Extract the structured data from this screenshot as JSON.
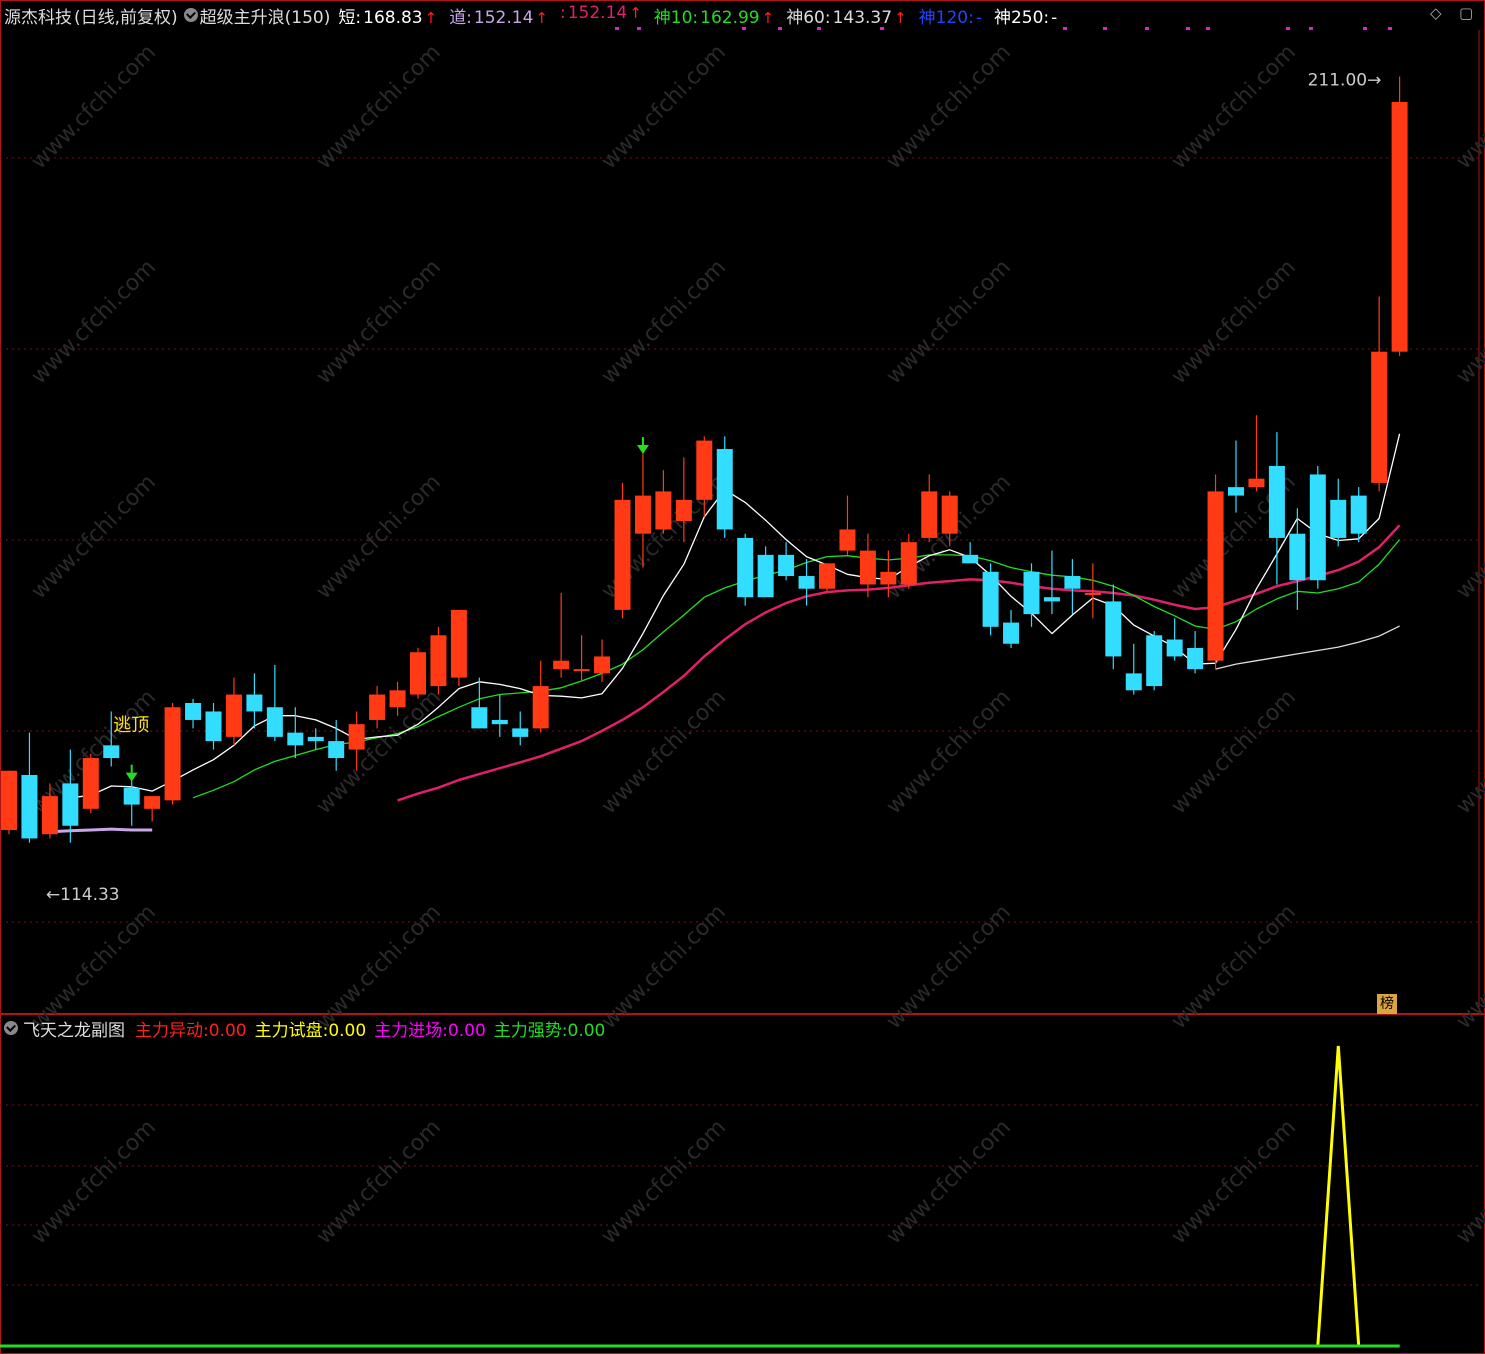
{
  "header": {
    "stock_name": "源杰科技",
    "period": "(日线,前复权)",
    "indicator_name": "超级主升浪(150)",
    "items": [
      {
        "label": "短:",
        "value": "168.83",
        "arrow": "↑",
        "label_color": "#ffffff",
        "value_color": "#ffffff"
      },
      {
        "label": "道:",
        "value": "152.14",
        "arrow": "↑",
        "label_color": "#c8a6e8",
        "value_color": "#c8a6e8"
      },
      {
        "label": ":",
        "value": "152.14",
        "arrow": "↑",
        "label_color": "#e0206a",
        "value_color": "#e0206a"
      },
      {
        "label": "神10:",
        "value": "162.99",
        "arrow": "↑",
        "label_color": "#22dd22",
        "value_color": "#22dd22"
      },
      {
        "label": "神60:",
        "value": "143.37",
        "arrow": "↑",
        "label_color": "#dddddd",
        "value_color": "#dddddd"
      },
      {
        "label": "神120:",
        "value": "-",
        "arrow": "",
        "label_color": "#2244ff",
        "value_color": "#2244ff"
      },
      {
        "label": "神250:",
        "value": "-",
        "arrow": "",
        "label_color": "#ffffff",
        "value_color": "#ffffff"
      }
    ]
  },
  "sub_header": {
    "title": "飞天之龙副图",
    "items": [
      {
        "label": "主力异动:",
        "value": "0.00",
        "color": "#ff2020"
      },
      {
        "label": "主力试盘:",
        "value": "0.00",
        "color": "#ffff00"
      },
      {
        "label": "主力进场:",
        "value": "0.00",
        "color": "#ff00ff"
      },
      {
        "label": "主力强势:",
        "value": "0.00",
        "color": "#22dd22"
      }
    ]
  },
  "annotations": {
    "high_label": "211.00",
    "low_label": "114.33",
    "escape_top": "逃顶"
  },
  "badge": "榜",
  "watermark": "www.cfchi.com",
  "colors": {
    "up": "#ff3a14",
    "down": "#33ddff",
    "ma_short": "#ffffff",
    "ma_green": "#22dd22",
    "ma_magenta": "#e0206a",
    "ma_lavender": "#c8a6e8",
    "ma_long": "#dddddd",
    "grid": "#7a1010",
    "border": "#b01515"
  },
  "chart_data": {
    "type": "candlestick",
    "price_axis": {
      "min": 100.5,
      "max": 216.5
    },
    "highest": 211.0,
    "lowest": 114.33,
    "candles": [
      {
        "o": 122.0,
        "h": 129.0,
        "l": 121.5,
        "c": 129.0
      },
      {
        "o": 128.5,
        "h": 133.5,
        "l": 120.5,
        "c": 121.0
      },
      {
        "o": 121.5,
        "h": 127.5,
        "l": 121.0,
        "c": 126.0
      },
      {
        "o": 127.5,
        "h": 131.5,
        "l": 120.5,
        "c": 122.5
      },
      {
        "o": 124.5,
        "h": 131.0,
        "l": 124.0,
        "c": 130.5
      },
      {
        "o": 132.0,
        "h": 136.0,
        "l": 129.5,
        "c": 130.5
      },
      {
        "o": 127.0,
        "h": 128.5,
        "l": 122.5,
        "c": 125.0
      },
      {
        "o": 124.5,
        "h": 126.0,
        "l": 123.0,
        "c": 126.0
      },
      {
        "o": 125.5,
        "h": 137.0,
        "l": 125.0,
        "c": 136.5
      },
      {
        "o": 137.0,
        "h": 137.5,
        "l": 134.0,
        "c": 135.0
      },
      {
        "o": 136.0,
        "h": 137.0,
        "l": 131.5,
        "c": 132.5
      },
      {
        "o": 133.0,
        "h": 140.0,
        "l": 132.0,
        "c": 138.0
      },
      {
        "o": 138.0,
        "h": 140.5,
        "l": 134.0,
        "c": 136.0
      },
      {
        "o": 136.5,
        "h": 141.5,
        "l": 132.5,
        "c": 133.0
      },
      {
        "o": 133.5,
        "h": 136.5,
        "l": 130.5,
        "c": 132.0
      },
      {
        "o": 133.0,
        "h": 134.0,
        "l": 131.5,
        "c": 132.5
      },
      {
        "o": 132.5,
        "h": 135.0,
        "l": 129.0,
        "c": 130.5
      },
      {
        "o": 131.5,
        "h": 136.0,
        "l": 129.0,
        "c": 134.5
      },
      {
        "o": 135.0,
        "h": 139.0,
        "l": 134.0,
        "c": 138.0
      },
      {
        "o": 136.5,
        "h": 139.5,
        "l": 135.5,
        "c": 138.5
      },
      {
        "o": 138.0,
        "h": 143.5,
        "l": 137.5,
        "c": 143.0
      },
      {
        "o": 139.0,
        "h": 146.0,
        "l": 138.0,
        "c": 145.0
      },
      {
        "o": 140.0,
        "h": 148.0,
        "l": 139.0,
        "c": 148.0
      },
      {
        "o": 136.5,
        "h": 140.0,
        "l": 134.0,
        "c": 134.0
      },
      {
        "o": 135.0,
        "h": 138.0,
        "l": 133.0,
        "c": 134.5
      },
      {
        "o": 134.0,
        "h": 136.0,
        "l": 132.0,
        "c": 133.0
      },
      {
        "o": 134.0,
        "h": 142.0,
        "l": 133.5,
        "c": 139.0
      },
      {
        "o": 141.0,
        "h": 150.0,
        "l": 140.0,
        "c": 142.0
      },
      {
        "o": 141.0,
        "h": 145.0,
        "l": 139.5,
        "c": 141.0
      },
      {
        "o": 140.5,
        "h": 144.5,
        "l": 139.5,
        "c": 142.5
      },
      {
        "o": 148.0,
        "h": 163.0,
        "l": 147.0,
        "c": 161.0
      },
      {
        "o": 157.0,
        "h": 166.5,
        "l": 153.0,
        "c": 161.5
      },
      {
        "o": 157.5,
        "h": 164.5,
        "l": 157.0,
        "c": 162.0
      },
      {
        "o": 158.5,
        "h": 166.0,
        "l": 156.0,
        "c": 161.0
      },
      {
        "o": 161.0,
        "h": 168.5,
        "l": 159.0,
        "c": 168.0
      },
      {
        "o": 167.0,
        "h": 168.5,
        "l": 156.5,
        "c": 157.5
      },
      {
        "o": 156.5,
        "h": 157.0,
        "l": 148.5,
        "c": 149.5
      },
      {
        "o": 154.5,
        "h": 155.5,
        "l": 149.5,
        "c": 149.5
      },
      {
        "o": 154.5,
        "h": 156.0,
        "l": 151.5,
        "c": 152.0
      },
      {
        "o": 152.0,
        "h": 154.0,
        "l": 148.5,
        "c": 150.5
      },
      {
        "o": 150.5,
        "h": 153.5,
        "l": 150.0,
        "c": 153.5
      },
      {
        "o": 155.0,
        "h": 161.5,
        "l": 154.5,
        "c": 157.5
      },
      {
        "o": 151.0,
        "h": 157.0,
        "l": 149.5,
        "c": 155.0
      },
      {
        "o": 151.0,
        "h": 155.0,
        "l": 149.5,
        "c": 152.5
      },
      {
        "o": 151.0,
        "h": 157.0,
        "l": 150.5,
        "c": 156.0
      },
      {
        "o": 156.5,
        "h": 164.0,
        "l": 156.0,
        "c": 162.0
      },
      {
        "o": 157.0,
        "h": 162.0,
        "l": 155.5,
        "c": 161.5
      },
      {
        "o": 154.5,
        "h": 156.0,
        "l": 153.5,
        "c": 153.5
      },
      {
        "o": 152.5,
        "h": 153.5,
        "l": 145.0,
        "c": 146.0
      },
      {
        "o": 146.5,
        "h": 148.0,
        "l": 143.5,
        "c": 144.0
      },
      {
        "o": 152.5,
        "h": 153.5,
        "l": 146.0,
        "c": 147.5
      },
      {
        "o": 149.5,
        "h": 155.0,
        "l": 147.5,
        "c": 149.0
      },
      {
        "o": 152.0,
        "h": 154.0,
        "l": 147.5,
        "c": 150.5
      },
      {
        "o": 150.0,
        "h": 153.5,
        "l": 147.0,
        "c": 150.0
      },
      {
        "o": 149.0,
        "h": 151.0,
        "l": 141.0,
        "c": 142.5
      },
      {
        "o": 140.5,
        "h": 144.0,
        "l": 138.0,
        "c": 138.5
      },
      {
        "o": 145.0,
        "h": 145.5,
        "l": 138.5,
        "c": 139.0
      },
      {
        "o": 144.5,
        "h": 147.0,
        "l": 142.0,
        "c": 142.5
      },
      {
        "o": 143.5,
        "h": 145.5,
        "l": 140.5,
        "c": 141.0
      },
      {
        "o": 142.0,
        "h": 164.0,
        "l": 141.0,
        "c": 162.0
      },
      {
        "o": 162.5,
        "h": 168.0,
        "l": 159.5,
        "c": 161.5
      },
      {
        "o": 162.5,
        "h": 171.0,
        "l": 162.0,
        "c": 163.5
      },
      {
        "o": 165.0,
        "h": 169.0,
        "l": 151.0,
        "c": 156.5
      },
      {
        "o": 157.0,
        "h": 160.0,
        "l": 148.0,
        "c": 151.5
      },
      {
        "o": 164.0,
        "h": 165.0,
        "l": 150.5,
        "c": 151.5
      },
      {
        "o": 161.0,
        "h": 163.5,
        "l": 155.5,
        "c": 156.5
      },
      {
        "o": 161.5,
        "h": 162.5,
        "l": 156.0,
        "c": 157.0
      },
      {
        "o": 163.0,
        "h": 185.0,
        "l": 162.0,
        "c": 178.5
      },
      {
        "o": 178.5,
        "h": 211.0,
        "l": 178.0,
        "c": 208.0
      }
    ],
    "ma_short": [
      null,
      null,
      null,
      125.8,
      126.1,
      127.2,
      127.1,
      126.6,
      127.8,
      129.1,
      130.3,
      132.0,
      134.3,
      135.5,
      135.5,
      135.0,
      134.0,
      132.7,
      133.0,
      133.2,
      134.5,
      136.5,
      138.7,
      139.5,
      139.2,
      138.7,
      137.9,
      137.8,
      137.6,
      138.1,
      141.1,
      145.2,
      149.7,
      153.4,
      159.0,
      162.2,
      160.7,
      158.6,
      156.3,
      154.3,
      153.3,
      152.2,
      151.8,
      151.6,
      153.1,
      154.4,
      155.1,
      154.2,
      152.1,
      149.6,
      147.6,
      145.2,
      147.4,
      149.4,
      148.5,
      146.2,
      144.9,
      143.6,
      141.6,
      141.7,
      145.7,
      150.5,
      154.6,
      158.8,
      157.0,
      156.2,
      156.4,
      158.8,
      168.8
    ],
    "ma_green": [
      null,
      null,
      null,
      null,
      null,
      null,
      null,
      null,
      null,
      125.8,
      126.7,
      127.7,
      129.1,
      130.1,
      130.8,
      131.5,
      132.1,
      132.4,
      132.9,
      133.4,
      134.2,
      135.4,
      136.5,
      137.5,
      138.0,
      138.2,
      138.4,
      138.8,
      139.6,
      140.5,
      141.6,
      143.3,
      145.4,
      147.4,
      149.5,
      150.6,
      151.4,
      152.1,
      152.7,
      153.6,
      154.3,
      154.4,
      154.1,
      153.9,
      154.1,
      154.5,
      154.5,
      154.4,
      153.8,
      153.0,
      152.5,
      152.1,
      151.9,
      151.5,
      150.8,
      149.7,
      148.4,
      147.3,
      146.1,
      145.7,
      146.6,
      148.1,
      149.3,
      150.2,
      150.0,
      150.5,
      151.3,
      153.4,
      156.3
    ],
    "ma_magenta": [
      null,
      null,
      null,
      null,
      null,
      null,
      null,
      null,
      null,
      null,
      null,
      null,
      null,
      null,
      null,
      null,
      null,
      null,
      null,
      125.5,
      126.3,
      127.0,
      127.9,
      128.6,
      129.3,
      130.0,
      130.7,
      131.6,
      132.5,
      133.7,
      135.0,
      136.5,
      138.3,
      140.2,
      142.5,
      144.5,
      146.3,
      147.7,
      148.8,
      149.6,
      150.1,
      150.3,
      150.4,
      150.6,
      150.9,
      151.2,
      151.4,
      151.6,
      151.5,
      151.2,
      150.8,
      150.5,
      150.3,
      150.2,
      150.0,
      149.7,
      149.2,
      148.6,
      148.1,
      148.3,
      149.1,
      149.9,
      150.8,
      151.4,
      152.0,
      152.7,
      153.7,
      155.4,
      158.0
    ],
    "ma_lavender": [
      null,
      null,
      121.8,
      121.9,
      122.0,
      122.1,
      122.0,
      122.0,
      null,
      null,
      null,
      null,
      null,
      null,
      null,
      null,
      null,
      null,
      null,
      null,
      null,
      null,
      null,
      null,
      null,
      null,
      null,
      null,
      null,
      null,
      null,
      null,
      null,
      null,
      null,
      null,
      null,
      null,
      null,
      null,
      null,
      null,
      null,
      null,
      null,
      null,
      null,
      null,
      null,
      null,
      null,
      null,
      null,
      null,
      null,
      null,
      null,
      null,
      null,
      null,
      null,
      null,
      null,
      null,
      null,
      null,
      null,
      null,
      null
    ],
    "ma_long": [
      null,
      null,
      null,
      null,
      null,
      null,
      null,
      null,
      null,
      null,
      null,
      null,
      null,
      null,
      null,
      null,
      null,
      null,
      null,
      null,
      null,
      null,
      null,
      null,
      null,
      null,
      null,
      null,
      null,
      null,
      null,
      null,
      null,
      null,
      null,
      null,
      null,
      null,
      null,
      null,
      null,
      null,
      null,
      null,
      null,
      null,
      null,
      null,
      null,
      null,
      null,
      null,
      null,
      null,
      null,
      null,
      null,
      null,
      null,
      141.0,
      141.6,
      142.0,
      142.4,
      142.8,
      143.2,
      143.6,
      144.2,
      144.9,
      146.1
    ],
    "sub_signal": [
      0,
      0,
      0,
      0,
      0,
      0,
      0,
      0,
      0,
      0,
      0,
      0,
      0,
      0,
      0,
      0,
      0,
      0,
      0,
      0,
      0,
      0,
      0,
      0,
      0,
      0,
      0,
      0,
      0,
      0,
      0,
      0,
      0,
      0,
      0,
      0,
      0,
      0,
      0,
      0,
      0,
      0,
      0,
      0,
      0,
      0,
      0,
      0,
      0,
      0,
      0,
      0,
      0,
      0,
      0,
      0,
      0,
      0,
      0,
      0,
      0,
      0,
      0,
      0,
      0,
      1,
      0,
      0,
      0
    ]
  }
}
